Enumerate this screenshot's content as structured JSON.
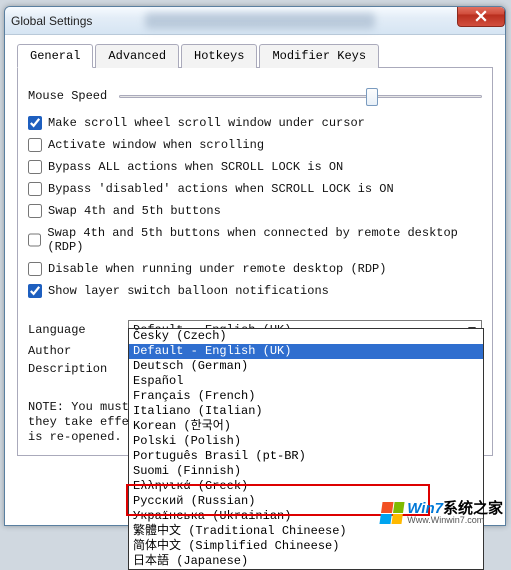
{
  "window": {
    "title": "Global Settings"
  },
  "tabs": [
    {
      "label": "General",
      "active": true
    },
    {
      "label": "Advanced",
      "active": false
    },
    {
      "label": "Hotkeys",
      "active": false
    },
    {
      "label": "Modifier Keys",
      "active": false
    }
  ],
  "general": {
    "mouse_speed_label": "Mouse Speed",
    "options": {
      "scroll_under_cursor": {
        "label": "Make scroll wheel scroll window under cursor",
        "checked": true
      },
      "activate_on_scroll": {
        "label": "Activate window when scrolling",
        "checked": false
      },
      "bypass_all_scrolllock": {
        "label": "Bypass ALL actions when SCROLL LOCK is ON",
        "checked": false
      },
      "bypass_disabled_scrolllock": {
        "label": "Bypass 'disabled' actions when SCROLL LOCK is ON",
        "checked": false
      },
      "swap_4_5": {
        "label": "Swap 4th and 5th buttons",
        "checked": false
      },
      "swap_4_5_rdp": {
        "label": "Swap 4th and 5th buttons when connected by remote desktop (RDP)",
        "checked": false
      },
      "disable_rdp": {
        "label": "Disable when running under remote desktop (RDP)",
        "checked": false
      },
      "balloon": {
        "label": "Show layer switch balloon notifications",
        "checked": true
      }
    },
    "language_label": "Language",
    "author_label": "Author",
    "description_label": "Description",
    "language_selected": "Default - English (UK)",
    "note_line1": "NOTE: You must",
    "note_line2": "they take effe",
    "note_line3": "is re-opened."
  },
  "dropdown": {
    "options": [
      "Česky (Czech)",
      "Default - English (UK)",
      "Deutsch (German)",
      "Español",
      "Français (French)",
      "Italiano (Italian)",
      "Korean (한국어)",
      "Polski (Polish)",
      "Português Brasil (pt-BR)",
      "Suomi (Finnish)",
      "Ελληνικά (Greek)",
      "Русский (Russian)",
      "Українська (Ukrainian)",
      "繁體中文 (Traditional Chineese)",
      "简体中文 (Simplified Chineese)",
      "日本語 (Japanese)"
    ],
    "selected_index": 1
  },
  "watermark": {
    "brand_prefix": "Win",
    "brand_num": "7",
    "brand_suffix": "系统之家",
    "url": "Www.Winwin7.com"
  }
}
